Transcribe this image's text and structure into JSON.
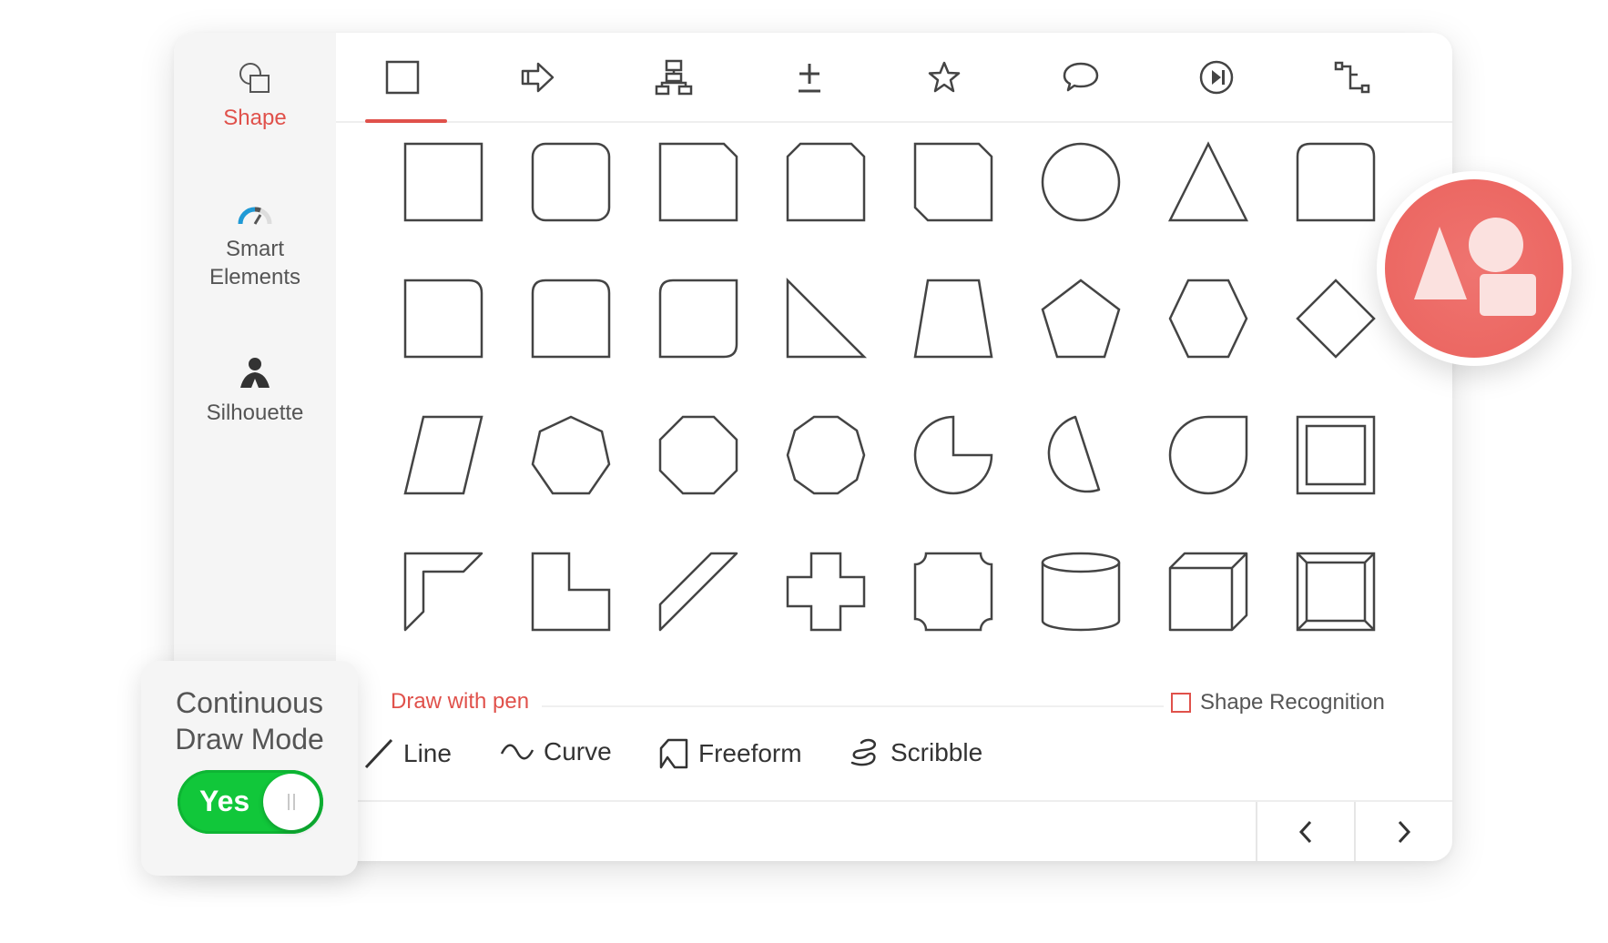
{
  "sidebar": {
    "items": [
      {
        "label": "Shape",
        "icon": "shape-icon",
        "active": true
      },
      {
        "label": "Smart Elements",
        "icon": "gauge-icon",
        "active": false
      },
      {
        "label": "Silhouette",
        "icon": "silhouette-icon",
        "active": false
      }
    ]
  },
  "tabs": [
    {
      "icon": "square-icon",
      "active": true
    },
    {
      "icon": "arrow-icon",
      "active": false
    },
    {
      "icon": "org-chart-icon",
      "active": false
    },
    {
      "icon": "math-plus-minus-icon",
      "active": false
    },
    {
      "icon": "star-icon",
      "active": false
    },
    {
      "icon": "speech-bubble-icon",
      "active": false
    },
    {
      "icon": "media-play-icon",
      "active": false
    },
    {
      "icon": "connector-icon",
      "active": false
    }
  ],
  "shapes": [
    [
      "rectangle",
      "rounded-rectangle",
      "snip-corner-rectangle",
      "snip-two-corner-rectangle",
      "snip-diagonal-rectangle",
      "circle",
      "triangle",
      "round-two-corner-rectangle"
    ],
    [
      "round-corner-rectangle",
      "round-top-rectangle",
      "round-diagonal-rectangle",
      "right-triangle",
      "trapezoid",
      "pentagon",
      "hexagon",
      "diamond"
    ],
    [
      "parallelogram",
      "heptagon",
      "octagon",
      "decagon",
      "pie",
      "chord",
      "teardrop",
      "frame"
    ],
    [
      "half-frame",
      "l-shape",
      "diagonal-stripe",
      "cross",
      "plaque",
      "cylinder",
      "cube",
      "bevel"
    ]
  ],
  "pen": {
    "section_label": "Draw with pen",
    "shape_recognition_label": "Shape Recognition",
    "tools": [
      {
        "label": "Line",
        "icon": "line-icon"
      },
      {
        "label": "Curve",
        "icon": "curve-icon"
      },
      {
        "label": "Freeform",
        "icon": "freeform-icon"
      },
      {
        "label": "Scribble",
        "icon": "scribble-icon"
      }
    ]
  },
  "pager": {
    "prev_icon": "chevron-left-icon",
    "next_icon": "chevron-right-icon"
  },
  "draw_mode": {
    "title_line1": "Continuous",
    "title_line2": "Draw Mode",
    "toggle_label": "Yes",
    "enabled": true
  },
  "colors": {
    "accent": "#e0514b",
    "toggle_on": "#11c73a",
    "badge": "#ec6863",
    "stroke": "#444444"
  }
}
